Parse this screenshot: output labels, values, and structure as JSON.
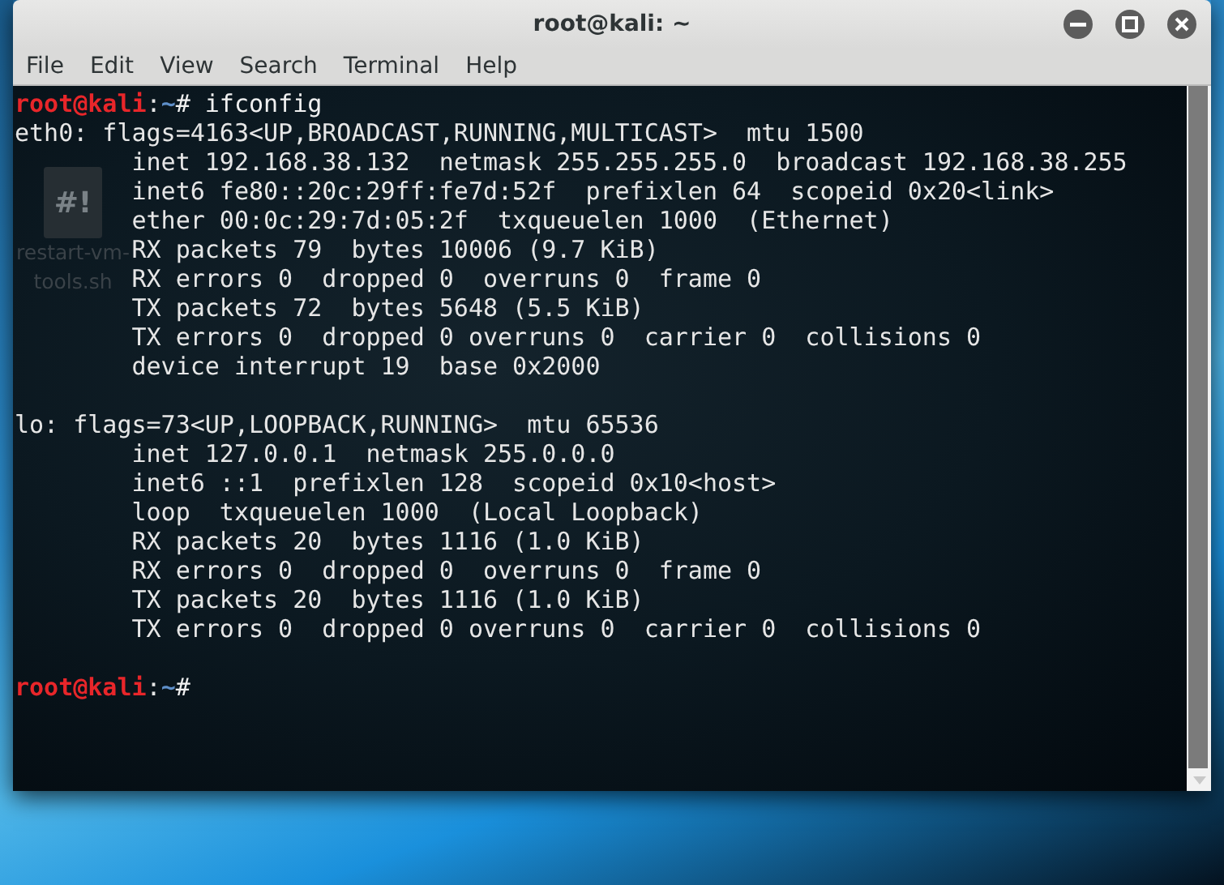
{
  "window": {
    "title": "root@kali: ~"
  },
  "menu": [
    "File",
    "Edit",
    "View",
    "Search",
    "Terminal",
    "Help"
  ],
  "desktop_icon": {
    "label_lines": [
      "restart-vm-",
      "tools.sh"
    ],
    "glyph": "#!"
  },
  "terminal": {
    "lines": [
      {
        "kind": "prompt",
        "user": "root@kali",
        "sep": ":",
        "path": "~",
        "command": "# ifconfig"
      },
      {
        "kind": "output",
        "text": "eth0: flags=4163<UP,BROADCAST,RUNNING,MULTICAST>  mtu 1500"
      },
      {
        "kind": "output",
        "text": "        inet 192.168.38.132  netmask 255.255.255.0  broadcast 192.168.38.255"
      },
      {
        "kind": "output",
        "text": "        inet6 fe80::20c:29ff:fe7d:52f  prefixlen 64  scopeid 0x20<link>"
      },
      {
        "kind": "output",
        "text": "        ether 00:0c:29:7d:05:2f  txqueuelen 1000  (Ethernet)"
      },
      {
        "kind": "output",
        "text": "        RX packets 79  bytes 10006 (9.7 KiB)"
      },
      {
        "kind": "output",
        "text": "        RX errors 0  dropped 0  overruns 0  frame 0"
      },
      {
        "kind": "output",
        "text": "        TX packets 72  bytes 5648 (5.5 KiB)"
      },
      {
        "kind": "output",
        "text": "        TX errors 0  dropped 0 overruns 0  carrier 0  collisions 0"
      },
      {
        "kind": "output",
        "text": "        device interrupt 19  base 0x2000"
      },
      {
        "kind": "blank"
      },
      {
        "kind": "output",
        "text": "lo: flags=73<UP,LOOPBACK,RUNNING>  mtu 65536"
      },
      {
        "kind": "output",
        "text": "        inet 127.0.0.1  netmask 255.0.0.0"
      },
      {
        "kind": "output",
        "text": "        inet6 ::1  prefixlen 128  scopeid 0x10<host>"
      },
      {
        "kind": "output",
        "text": "        loop  txqueuelen 1000  (Local Loopback)"
      },
      {
        "kind": "output",
        "text": "        RX packets 20  bytes 1116 (1.0 KiB)"
      },
      {
        "kind": "output",
        "text": "        RX errors 0  dropped 0  overruns 0  frame 0"
      },
      {
        "kind": "output",
        "text": "        TX packets 20  bytes 1116 (1.0 KiB)"
      },
      {
        "kind": "output",
        "text": "        TX errors 0  dropped 0 overruns 0  carrier 0  collisions 0"
      },
      {
        "kind": "blank"
      },
      {
        "kind": "prompt",
        "user": "root@kali",
        "sep": ":",
        "path": "~",
        "command": "#"
      }
    ]
  }
}
